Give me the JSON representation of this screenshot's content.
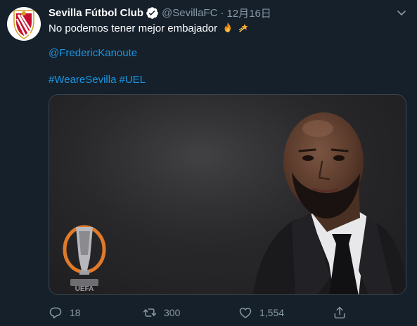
{
  "tweet": {
    "author": {
      "display_name": "Sevilla Fútbol Club",
      "handle": "@SevillaFC",
      "separator": "·",
      "timestamp": "12月16日",
      "verified": true,
      "avatar_icon": "sevilla-crest-icon"
    },
    "text": "No podemos tener mejor embajador",
    "emojis": [
      "fire-emoji",
      "dizzy-emoji"
    ],
    "mention": "@FredericKanoute",
    "hashtags": [
      "#WeareSevilla",
      "#UEL"
    ],
    "media": {
      "type": "photo",
      "description_icon": "europa-league-trophy-icon",
      "logo_text": "UEFA"
    },
    "actions": {
      "reply_count": "18",
      "retweet_count": "300",
      "like_count": "1,554",
      "share_icon": "share-icon"
    }
  },
  "colors": {
    "background": "#15202b",
    "text": "#ffffff",
    "secondary": "#8899a6",
    "link": "#1b95e0",
    "verified": "#ffffff"
  }
}
